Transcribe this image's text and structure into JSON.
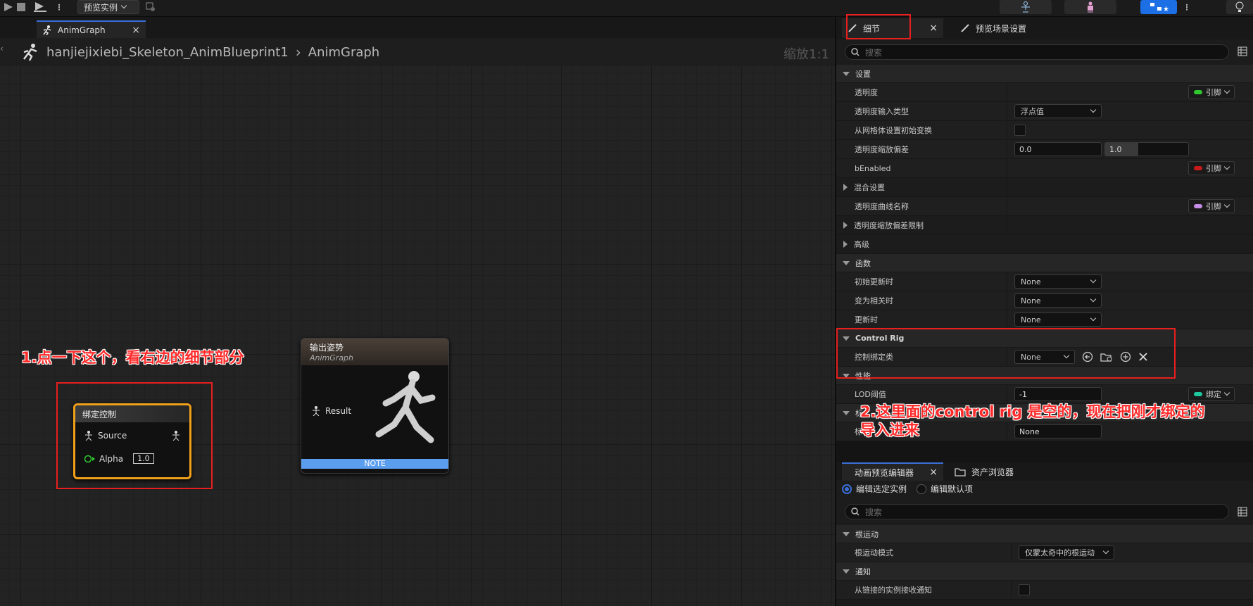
{
  "toolbar": {
    "preview_label": "预览实例"
  },
  "doc_tab": {
    "label": "AnimGraph"
  },
  "breadcrumb": {
    "blueprint": "hanjiejixiebi_Skeleton_AnimBlueprint1",
    "graph": "AnimGraph",
    "zoom": "缩放1:1"
  },
  "nodes": {
    "bind": {
      "title": "绑定控制",
      "source_label": "Source",
      "alpha_label": "Alpha",
      "alpha_value": "1.0"
    },
    "output": {
      "title": "输出姿势",
      "subtitle": "AnimGraph",
      "result_label": "Result",
      "note": "NOTE"
    }
  },
  "annotations": {
    "step1": "1.点一下这个，看右边的细节部分",
    "step2_line1": "2.这里面的control rig 是空的，现在把刚才绑定的",
    "step2_line2": "导入进来"
  },
  "details": {
    "tab_details": "细节",
    "tab_preview": "预览场景设置",
    "search_placeholder": "搜索",
    "sec_settings": "设置",
    "opacity": "透明度",
    "opacity_pin": "引脚",
    "opacity_input_type": "透明度输入类型",
    "opacity_input_value": "浮点值",
    "init_from_mesh": "从网格体设置初始变换",
    "opacity_scale_bias": "透明度缩放偏差",
    "scale_bias_a": "0.0",
    "scale_bias_b": "1.0",
    "benabled": "bEnabled",
    "benabled_pin": "引脚",
    "blend_settings": "混合设置",
    "opacity_curve_name": "透明度曲线名称",
    "curve_pin": "引脚",
    "scale_bias_clamp": "透明度缩放偏差限制",
    "advanced": "高级",
    "sec_functions": "函数",
    "on_initial_update": "初始更新时",
    "on_initial_update_value": "None",
    "on_become_relevant": "变为相关时",
    "on_become_relevant_value": "None",
    "on_update": "更新时",
    "on_update_value": "None",
    "sec_control_rig": "Control Rig",
    "control_rig_class": "控制绑定类",
    "control_rig_class_value": "None",
    "sec_performance": "性能",
    "lod_threshold": "LOD阈值",
    "lod_value": "-1",
    "lod_pin": "绑定",
    "tag_section": "标",
    "tag_row": "标",
    "tag_value": "None"
  },
  "anim_preview": {
    "tab_editor": "动画预览编辑器",
    "tab_assets": "资产浏览器",
    "radio_selected": "编辑选定实例",
    "radio_defaults": "编辑默认项",
    "search_placeholder": "搜索",
    "sec_root_motion": "根运动",
    "root_motion_mode": "根运动模式",
    "root_motion_value": "仅蒙太奇中的根运动",
    "sec_notify": "通知",
    "receive_notify": "从链接的实例接收通知"
  },
  "colors": {
    "accent": "#3a6fd8",
    "highlight": "#e81f1f",
    "pin_green": "#2ec92e",
    "pin_red": "#c81a1a",
    "pin_purple": "#c78ce6",
    "pin_teal": "#1ec9a0",
    "note_blue": "#5b9ef0"
  }
}
